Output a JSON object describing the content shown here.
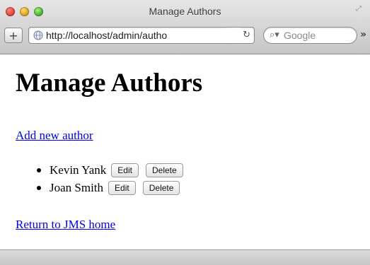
{
  "window": {
    "title": "Manage Authors"
  },
  "toolbar": {
    "add_tab_icon": "+",
    "url": "http://localhost/admin/autho",
    "search_placeholder": "Google",
    "reload_icon": "reload-icon",
    "overflow_icon": "»"
  },
  "page": {
    "title": "Manage Authors",
    "add_link": "Add new author",
    "authors": [
      {
        "name": "Kevin Yank",
        "edit_label": "Edit",
        "delete_label": "Delete"
      },
      {
        "name": "Joan Smith",
        "edit_label": "Edit",
        "delete_label": "Delete"
      }
    ],
    "return_link": "Return to JMS home"
  },
  "colors": {
    "link": "#0000ee",
    "close": "#e0443e",
    "minimize": "#dea123",
    "zoom": "#52b433"
  }
}
